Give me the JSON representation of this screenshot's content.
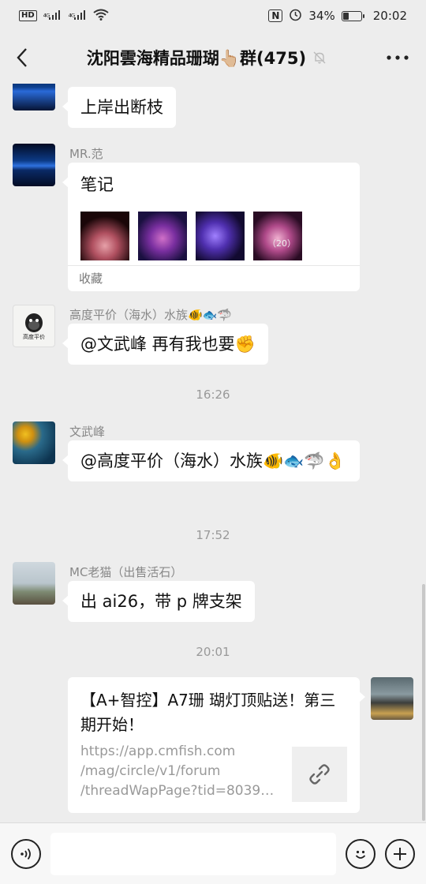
{
  "status_bar": {
    "hd": "HD",
    "signal1": "⁴ᴳ",
    "signal2": "⁴ᴳ",
    "nfc": "N",
    "battery": "34%",
    "battery_level": 0.34,
    "time": "20:02"
  },
  "header": {
    "back_icon": "chevron-left-icon",
    "title": "沈阳雲海精品珊瑚👆🏼群(475)",
    "mute_icon": "bell-off-icon",
    "more_icon": "more-icon"
  },
  "messages": [
    {
      "type": "text",
      "text": "上岸出断枝"
    },
    {
      "type": "favorite",
      "sender": "MR.范",
      "title": "笔记",
      "thumb_count": "（20）",
      "label": "收藏"
    },
    {
      "type": "text",
      "sender": "高度平价（海水）水族🐠🐟🦈",
      "text": "@文武峰  再有我也要✊",
      "avatar_text": "高度平价"
    },
    {
      "type": "time",
      "text": "16:26"
    },
    {
      "type": "text",
      "sender": "文武峰",
      "text": "@高度平价（海水）水族🐠🐟🦈👌"
    },
    {
      "type": "time",
      "text": "17:52"
    },
    {
      "type": "text",
      "sender": "MC老猫（出售活石）",
      "text": "出 ai26，带 p 牌支架"
    },
    {
      "type": "time",
      "text": "20:01"
    },
    {
      "type": "link",
      "title": "【A+智控】A7珊 瑚灯顶贴送！第三期开始！",
      "url_lines": [
        "https://app.cmfish.com",
        "/mag/circle/v1/forum",
        "/threadWapPage?tid=8039…"
      ]
    }
  ],
  "input_bar": {
    "voice_icon": "voice-icon",
    "emoji_icon": "emoji-icon",
    "add_icon": "plus-icon",
    "placeholder": ""
  }
}
